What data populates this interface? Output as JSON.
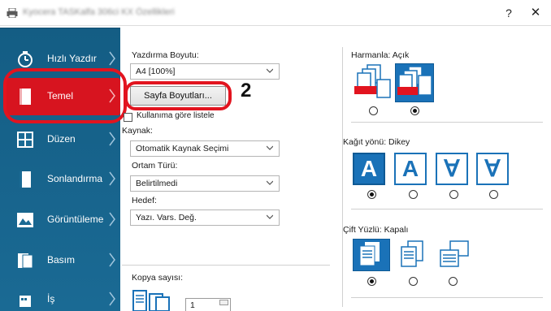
{
  "window": {
    "title": "Kyocera TASKalfa 306ci KX Özellikleri",
    "help": "?",
    "close": "✕"
  },
  "sidebar": {
    "items": [
      {
        "label": "Hızlı Yazdır",
        "icon": "quick-print-icon"
      },
      {
        "label": "Temel",
        "icon": "basic-page-icon",
        "active": true
      },
      {
        "label": "Düzen",
        "icon": "layout-icon"
      },
      {
        "label": "Sonlandırma",
        "icon": "finishing-icon"
      },
      {
        "label": "Görüntüleme",
        "icon": "imaging-icon"
      },
      {
        "label": "Basım",
        "icon": "publishing-icon"
      },
      {
        "label": "İş",
        "icon": "job-icon"
      }
    ],
    "colors": {
      "background": "#1a6a94",
      "active": "#d7141f"
    }
  },
  "basic": {
    "print_size_label": "Yazdırma Boyutu:",
    "print_size_value": "A4 [100%]",
    "page_sizes_button": "Sayfa Boyutları...",
    "step_number": "2",
    "usage_list_label": "Kullanıma göre listele",
    "source_label": "Kaynak:",
    "source_value": "Otomatik Kaynak Seçimi",
    "media_label": "Ortam Türü:",
    "media_value": "Belirtilmedi",
    "target_label": "Hedef:",
    "target_value": "Yazı. Vars. Değ.",
    "copies_label": "Kopya sayısı:",
    "copies_value": "1"
  },
  "collate": {
    "label": "Harmanla:",
    "value": "Açık",
    "options": [
      {
        "icon": "uncollated-icon",
        "selected": false
      },
      {
        "icon": "collated-icon",
        "selected": true
      }
    ]
  },
  "orientation": {
    "label": "Kağıt yönü:",
    "value": "Dikey",
    "options": [
      {
        "glyph": "A",
        "icon": "portrait-icon",
        "selected": true
      },
      {
        "glyph": "A",
        "icon": "landscape-icon",
        "selected": false
      },
      {
        "glyph": "∀",
        "icon": "portrait-rotated-icon",
        "selected": false
      },
      {
        "glyph": "∀",
        "icon": "landscape-rotated-icon",
        "selected": false
      }
    ]
  },
  "duplex": {
    "label": "Çift Yüzlü:",
    "value": "Kapalı",
    "options": [
      {
        "icon": "simplex-icon",
        "selected": true
      },
      {
        "icon": "duplex-long-edge-icon",
        "selected": false
      },
      {
        "icon": "duplex-short-edge-icon",
        "selected": false
      }
    ]
  },
  "accent": "#1a72b8",
  "highlight": "#e2141f"
}
